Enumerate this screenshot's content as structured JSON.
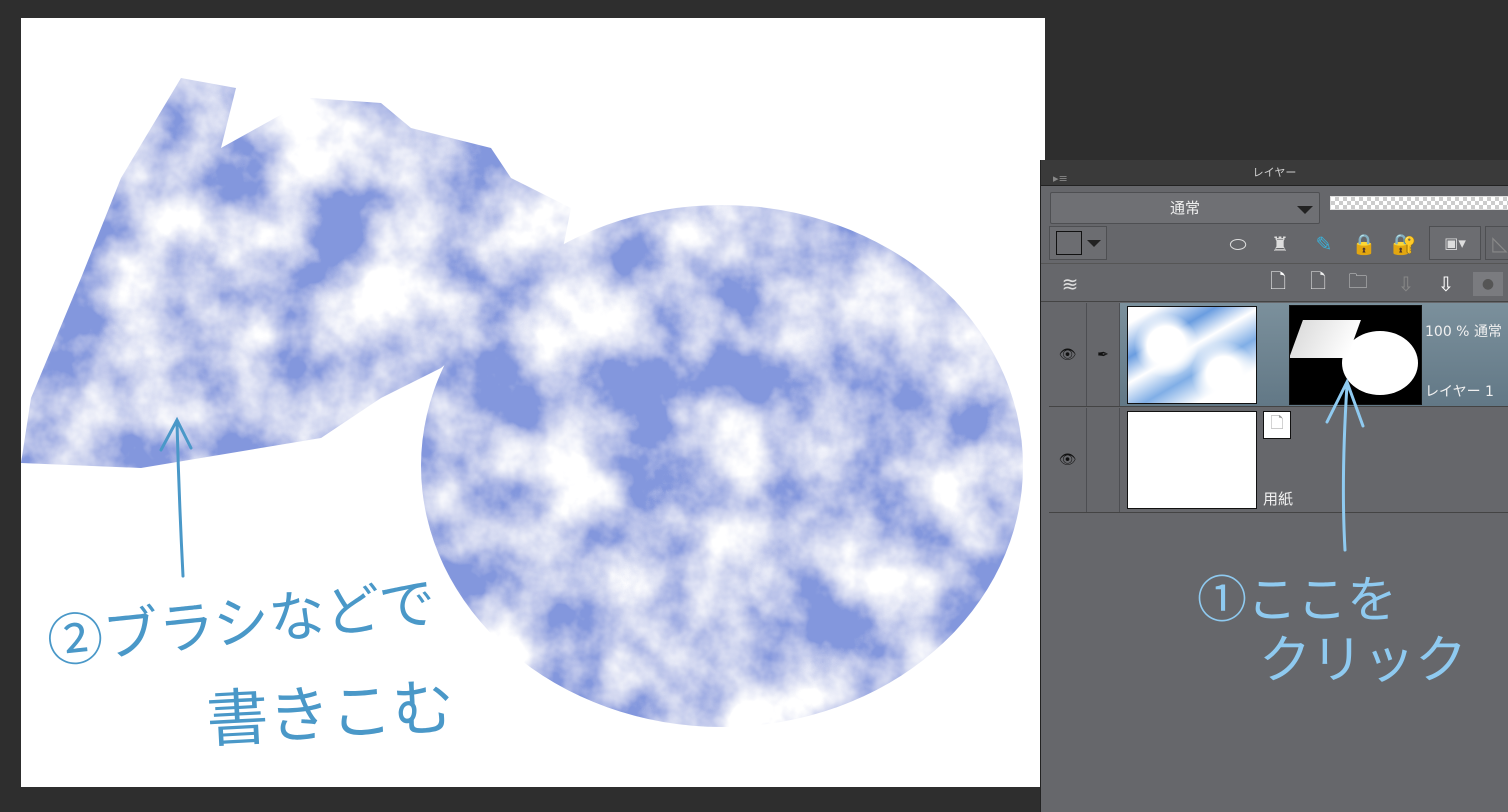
{
  "panel": {
    "title": "レイヤー",
    "blend_mode": "通常",
    "layers": [
      {
        "name": "レイヤー 1",
        "opacity": "100 %",
        "mode": "通常",
        "selected": true,
        "has_mask": true
      },
      {
        "name": "用紙",
        "selected": false
      }
    ]
  },
  "annotations": {
    "step2_line1": "②ブラシなどで",
    "step2_line2": "書きこむ",
    "step1_line1": "①ここを",
    "step1_line2": "クリック"
  },
  "colors": {
    "annotation_left": "#4a98c8",
    "annotation_right": "#8fcaf0",
    "panel_bg": "#66676b",
    "selected_layer": "#6f8796"
  }
}
